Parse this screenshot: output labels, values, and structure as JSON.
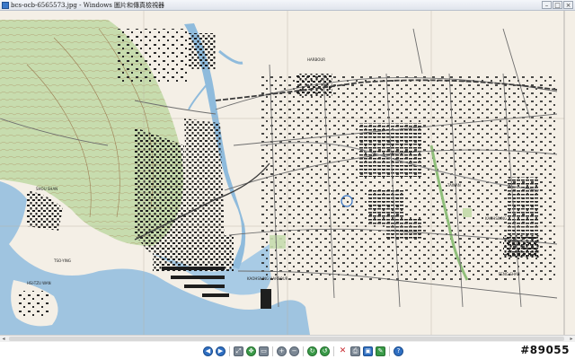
{
  "window": {
    "title": "bcs-ocb-6565573.jpg - Windows 圖片和傳真檢視器",
    "controls": {
      "minimize": "–",
      "maximize": "□",
      "close": "×"
    }
  },
  "map": {
    "labels": [
      "HARBOUR",
      "TAINAN",
      "KAOHSIUNG",
      "SHOU SHAN",
      "KAOHSIUNG HARBOUR",
      "TSO-YING",
      "HSI-TZU WAN",
      "FENG-SHAN"
    ]
  },
  "toolbar": {
    "buttons": [
      {
        "icon": "previous-image-icon",
        "glyph": "◀"
      },
      {
        "icon": "next-image-icon",
        "glyph": "▶"
      },
      {
        "icon": "best-fit-icon",
        "glyph": "⤢"
      },
      {
        "icon": "actual-size-icon",
        "glyph": "✥"
      },
      {
        "icon": "slideshow-icon",
        "glyph": "▭"
      },
      {
        "icon": "zoom-in-icon",
        "glyph": "+"
      },
      {
        "icon": "zoom-out-icon",
        "glyph": "−"
      },
      {
        "icon": "rotate-clockwise-icon",
        "glyph": "↻"
      },
      {
        "icon": "rotate-counterclockwise-icon",
        "glyph": "↺"
      },
      {
        "icon": "delete-icon",
        "glyph": "✕"
      },
      {
        "icon": "print-icon",
        "glyph": "⎙"
      },
      {
        "icon": "save-copy-icon",
        "glyph": "▣"
      },
      {
        "icon": "open-editor-icon",
        "glyph": "✎"
      },
      {
        "icon": "help-icon",
        "glyph": "?"
      }
    ]
  },
  "watermark": "#89055",
  "colors": {
    "water": "#9fc4e0",
    "land": "#f4efe6",
    "hill": "#c7dcae",
    "buildings": "#1e1e1e",
    "roads": "#6e6e6e",
    "railway": "#3c3c3c"
  }
}
